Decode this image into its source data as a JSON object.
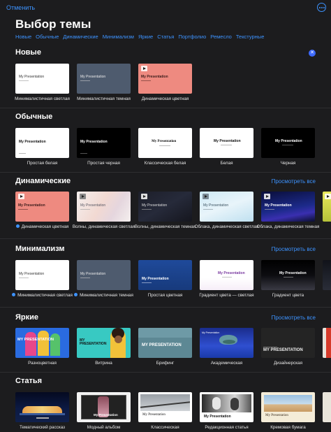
{
  "header": {
    "cancel_label": "Отменить",
    "title": "Выбор темы",
    "more_icon": "ellipsis-circle-icon"
  },
  "categories": [
    "Новые",
    "Обычные",
    "Динамические",
    "Минимализм",
    "Яркие",
    "Статья",
    "Портфолио",
    "Ремесло",
    "Текстурные"
  ],
  "sections": {
    "new": {
      "title": "Новые",
      "close_icon": "close-circle-icon"
    },
    "regular": {
      "title": "Обычные"
    },
    "dynamic": {
      "title": "Динамические",
      "see_all": "Просмотреть все"
    },
    "minimal": {
      "title": "Минимализм",
      "see_all": "Просмотреть все"
    },
    "bright": {
      "title": "Яркие",
      "see_all": "Просмотреть все"
    },
    "article": {
      "title": "Статья"
    }
  },
  "themes": {
    "new": [
      {
        "name": "Минималистичная светлая",
        "thumb_title": "My Presentation"
      },
      {
        "name": "Минималистичная темная",
        "thumb_title": "My Presentation"
      },
      {
        "name": "Динамическая цветная",
        "thumb_title": "My Presentation"
      }
    ],
    "regular": [
      {
        "name": "Простая белая",
        "thumb_title": "My Presentation"
      },
      {
        "name": "Простая черная",
        "thumb_title": "My Presentation"
      },
      {
        "name": "Классическая белая",
        "thumb_title": "My Presentation"
      },
      {
        "name": "Белая",
        "thumb_title": "My Presentation"
      },
      {
        "name": "Черная",
        "thumb_title": "My Presentation"
      }
    ],
    "dynamic": [
      {
        "name": "Динамическая цветная",
        "thumb_title": "My Presentation"
      },
      {
        "name": "Волны, динамическая светлая",
        "thumb_title": "My Presentation"
      },
      {
        "name": "Волны, динамическая темная",
        "thumb_title": "My Presentation"
      },
      {
        "name": "Облака, динамическая светлая",
        "thumb_title": "My Presentation"
      },
      {
        "name": "Облака, динамическая темная",
        "thumb_title": "My Presentation"
      }
    ],
    "minimal": [
      {
        "name": "Минималистичная светлая",
        "thumb_title": "My Presentation"
      },
      {
        "name": "Минималистичная темная",
        "thumb_title": "My Presentation"
      },
      {
        "name": "Простая цветная",
        "thumb_title": "My Presentation"
      },
      {
        "name": "Градиент цвета — светлая",
        "thumb_title": "My Presentation"
      },
      {
        "name": "Градиент цвета",
        "thumb_title": "My Presentation"
      }
    ],
    "bright": [
      {
        "name": "Разноцветная",
        "thumb_title": "MY PRESENTATION"
      },
      {
        "name": "Витрина",
        "thumb_title": "MY PRESENTATION"
      },
      {
        "name": "Брифинг",
        "thumb_title": "MY PRESENTATION"
      },
      {
        "name": "Академическая",
        "thumb_title": "My Presentation"
      },
      {
        "name": "Дизайнерская",
        "thumb_title": "MY PRESENTATION"
      }
    ],
    "article": [
      {
        "name": "Тематический рассказ"
      },
      {
        "name": "Модный альбом",
        "thumb_title": "My Presentation"
      },
      {
        "name": "Классическая",
        "thumb_title": "My Presentation"
      },
      {
        "name": "Редакционная статья",
        "thumb_title": "My Presentation"
      },
      {
        "name": "Кремовая бумага",
        "thumb_title": "My Presentation"
      }
    ]
  },
  "accent_color": "#3d93ff"
}
